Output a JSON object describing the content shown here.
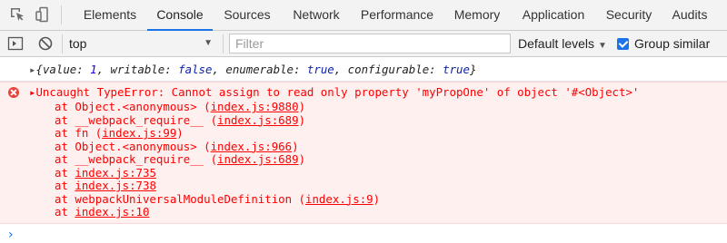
{
  "tabs": [
    "Elements",
    "Console",
    "Sources",
    "Network",
    "Performance",
    "Memory",
    "Application",
    "Security",
    "Audits"
  ],
  "active_tab": "Console",
  "toolbar": {
    "context": "top",
    "filter_placeholder": "Filter",
    "levels": "Default levels",
    "group_similar": "Group similar",
    "group_similar_checked": true
  },
  "console": {
    "object_line": {
      "open": "{",
      "value_key": "value: ",
      "value": "1",
      "writable_key": ", writable: ",
      "writable": "false",
      "enumerable_key": ", enumerable: ",
      "enumerable": "true",
      "configurable_key": ", configurable: ",
      "configurable": "true",
      "close": "}"
    },
    "error": {
      "message": "Uncaught TypeError: Cannot assign to read only property 'myPropOne' of object '#<Object>'",
      "frames": [
        {
          "prefix": "at Object.<anonymous> (",
          "loc": "index.js:9880",
          "suffix": ")"
        },
        {
          "prefix": "at __webpack_require__ (",
          "loc": "index.js:689",
          "suffix": ")"
        },
        {
          "prefix": "at fn (",
          "loc": "index.js:99",
          "suffix": ")"
        },
        {
          "prefix": "at Object.<anonymous> (",
          "loc": "index.js:966",
          "suffix": ")"
        },
        {
          "prefix": "at __webpack_require__ (",
          "loc": "index.js:689",
          "suffix": ")"
        },
        {
          "prefix": "at ",
          "loc": "index.js:735",
          "suffix": ""
        },
        {
          "prefix": "at ",
          "loc": "index.js:738",
          "suffix": ""
        },
        {
          "prefix": "at webpackUniversalModuleDefinition (",
          "loc": "index.js:9",
          "suffix": ")"
        },
        {
          "prefix": "at ",
          "loc": "index.js:10",
          "suffix": ""
        }
      ]
    },
    "prompt_symbol": "›"
  },
  "colors": {
    "accent": "#1a73e8",
    "error_text": "#fe0000",
    "error_bg": "#fff0f0"
  }
}
